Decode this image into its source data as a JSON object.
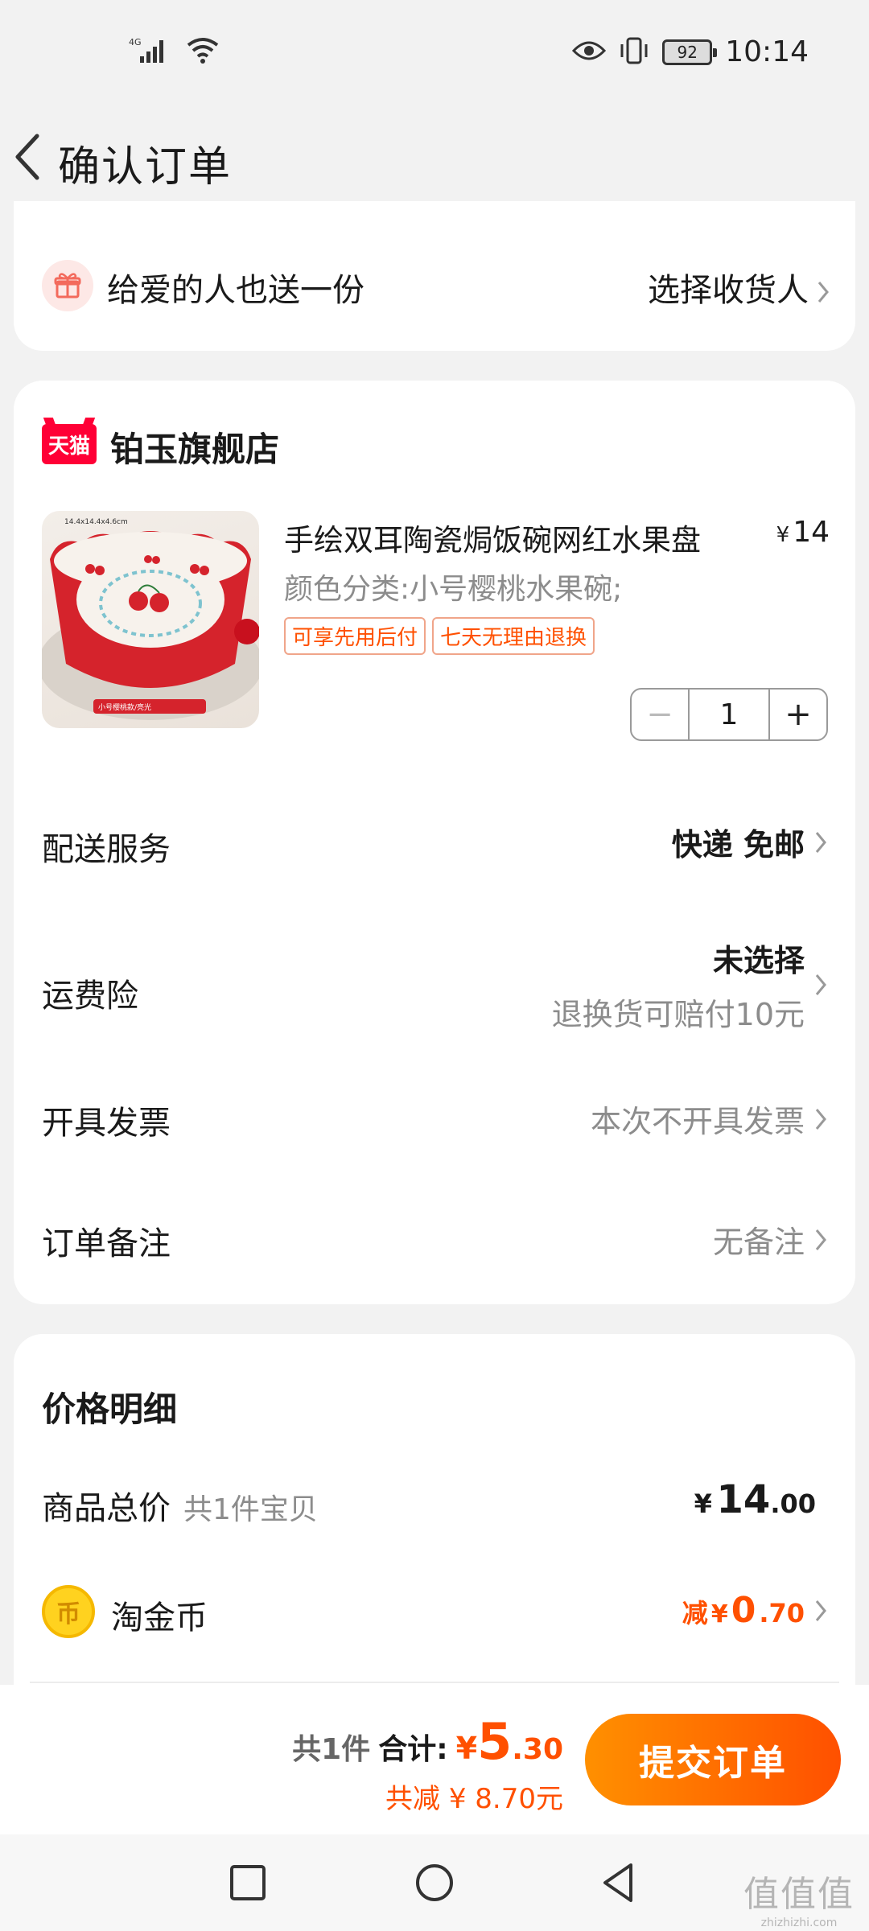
{
  "status_bar": {
    "signal": "4G",
    "battery": "92",
    "time": "10:14"
  },
  "header": {
    "title": "确认订单"
  },
  "gift": {
    "text": "给爱的人也送一份",
    "action": "选择收货人"
  },
  "shop": {
    "logo_text": "天猫",
    "name": "铂玉旗舰店"
  },
  "product": {
    "title": "手绘双耳陶瓷焗饭碗网红水果盘",
    "price_symbol": "¥",
    "price": "14",
    "spec": "颜色分类:小号樱桃水果碗;",
    "tags": [
      "可享先用后付",
      "七天无理由退换"
    ],
    "quantity": "1",
    "image_caption_top": "14.4x14.4x4.6cm",
    "image_caption_bottom": "小号樱桃款/亮光"
  },
  "rows": {
    "delivery_label": "配送服务",
    "delivery_value": "快递 免邮",
    "insurance_label": "运费险",
    "insurance_value": "未选择",
    "insurance_note": "退换货可赔付10元",
    "invoice_label": "开具发票",
    "invoice_value": "本次不开具发票",
    "remark_label": "订单备注",
    "remark_value": "无备注"
  },
  "price_detail": {
    "title": "价格明细",
    "goods_label": "商品总价",
    "goods_count": "共1件宝贝",
    "goods_yen": "¥",
    "goods_int": "14",
    "goods_dec": ".00",
    "coin_label": "淘金币",
    "coin_prefix": "减",
    "coin_yen": "¥",
    "coin_int": "0",
    "coin_dec": ".70"
  },
  "bottom": {
    "count": "共1件",
    "total_label": "合计:",
    "total_yen": "¥",
    "total_int": "5",
    "total_dec": ".30",
    "saved": "共减 ¥ 8.70元",
    "submit": "提交订单"
  },
  "watermark": {
    "big": "值值值",
    "small": "zhizhizhi.com"
  },
  "colors": {
    "accent": "#ff5000",
    "tmall": "#ff0036",
    "coin": "#ffd21f"
  }
}
